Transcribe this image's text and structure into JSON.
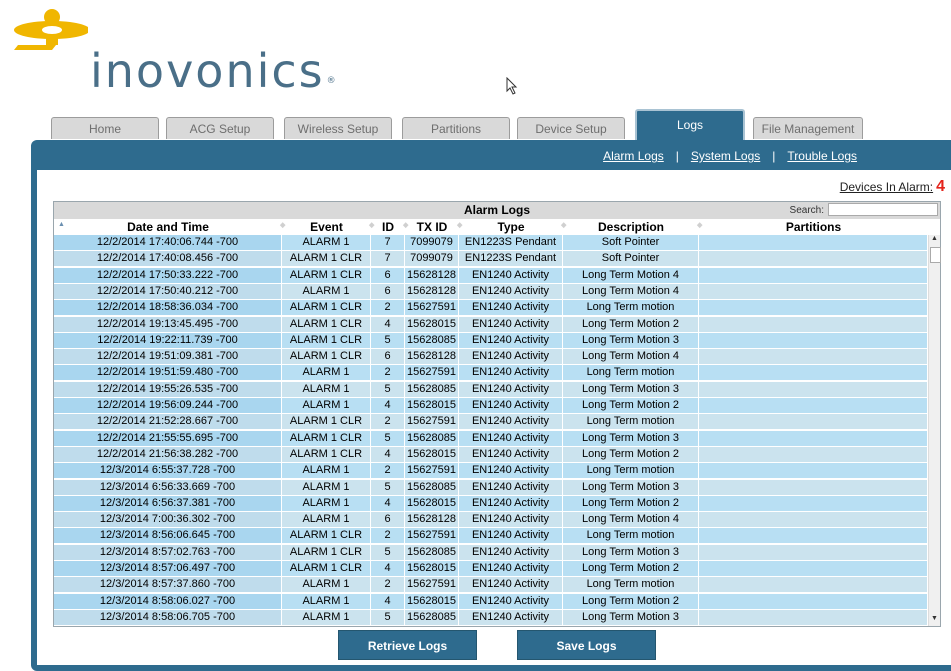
{
  "brand": {
    "name": "inovonics",
    "reg": "®",
    "logo_color": "#4a6f88",
    "accent": "#f0b600"
  },
  "tabs": [
    {
      "label": "Home",
      "active": false
    },
    {
      "label": "ACG Setup",
      "active": false
    },
    {
      "label": "Wireless Setup",
      "active": false
    },
    {
      "label": "Partitions",
      "active": false
    },
    {
      "label": "Device Setup",
      "active": false
    },
    {
      "label": "Logs",
      "active": true
    },
    {
      "label": "File Management",
      "active": false
    }
  ],
  "subnav": {
    "alarm_logs": "Alarm Logs",
    "system_logs": "System Logs",
    "trouble_logs": "Trouble Logs",
    "separator": "|"
  },
  "devices_in_alarm": {
    "label": "Devices In Alarm:",
    "count": "4"
  },
  "table": {
    "title": "Alarm Logs",
    "search_label": "Search:",
    "search_value": "",
    "columns": [
      "Date and Time",
      "Event",
      "ID",
      "TX ID",
      "Type",
      "Description",
      "Partitions"
    ],
    "rows": [
      [
        "12/2/2014 17:40:06.744 -700",
        "ALARM 1",
        "7",
        "7099079",
        "EN1223S Pendant",
        "Soft Pointer",
        ""
      ],
      [
        "12/2/2014 17:40:08.456 -700",
        "ALARM 1 CLR",
        "7",
        "7099079",
        "EN1223S Pendant",
        "Soft Pointer",
        ""
      ],
      [
        "12/2/2014 17:50:33.222 -700",
        "ALARM 1 CLR",
        "6",
        "15628128",
        "EN1240 Activity",
        "Long Term Motion 4",
        ""
      ],
      [
        "12/2/2014 17:50:40.212 -700",
        "ALARM 1",
        "6",
        "15628128",
        "EN1240 Activity",
        "Long Term Motion 4",
        ""
      ],
      [
        "12/2/2014 18:58:36.034 -700",
        "ALARM 1 CLR",
        "2",
        "15627591",
        "EN1240 Activity",
        "Long Term motion",
        ""
      ],
      [
        "12/2/2014 19:13:45.495 -700",
        "ALARM 1 CLR",
        "4",
        "15628015",
        "EN1240 Activity",
        "Long Term Motion 2",
        ""
      ],
      [
        "12/2/2014 19:22:11.739 -700",
        "ALARM 1 CLR",
        "5",
        "15628085",
        "EN1240 Activity",
        "Long Term Motion 3",
        ""
      ],
      [
        "12/2/2014 19:51:09.381 -700",
        "ALARM 1 CLR",
        "6",
        "15628128",
        "EN1240 Activity",
        "Long Term Motion 4",
        ""
      ],
      [
        "12/2/2014 19:51:59.480 -700",
        "ALARM 1",
        "2",
        "15627591",
        "EN1240 Activity",
        "Long Term motion",
        ""
      ],
      [
        "12/2/2014 19:55:26.535 -700",
        "ALARM 1",
        "5",
        "15628085",
        "EN1240 Activity",
        "Long Term Motion 3",
        ""
      ],
      [
        "12/2/2014 19:56:09.244 -700",
        "ALARM 1",
        "4",
        "15628015",
        "EN1240 Activity",
        "Long Term Motion 2",
        ""
      ],
      [
        "12/2/2014 21:52:28.667 -700",
        "ALARM 1 CLR",
        "2",
        "15627591",
        "EN1240 Activity",
        "Long Term motion",
        ""
      ],
      [
        "12/2/2014 21:55:55.695 -700",
        "ALARM 1 CLR",
        "5",
        "15628085",
        "EN1240 Activity",
        "Long Term Motion 3",
        ""
      ],
      [
        "12/2/2014 21:56:38.282 -700",
        "ALARM 1 CLR",
        "4",
        "15628015",
        "EN1240 Activity",
        "Long Term Motion 2",
        ""
      ],
      [
        "12/3/2014 6:55:37.728 -700",
        "ALARM 1",
        "2",
        "15627591",
        "EN1240 Activity",
        "Long Term motion",
        ""
      ],
      [
        "12/3/2014 6:56:33.669 -700",
        "ALARM 1",
        "5",
        "15628085",
        "EN1240 Activity",
        "Long Term Motion 3",
        ""
      ],
      [
        "12/3/2014 6:56:37.381 -700",
        "ALARM 1",
        "4",
        "15628015",
        "EN1240 Activity",
        "Long Term Motion 2",
        ""
      ],
      [
        "12/3/2014 7:00:36.302 -700",
        "ALARM 1",
        "6",
        "15628128",
        "EN1240 Activity",
        "Long Term Motion 4",
        ""
      ],
      [
        "12/3/2014 8:56:06.645 -700",
        "ALARM 1 CLR",
        "2",
        "15627591",
        "EN1240 Activity",
        "Long Term motion",
        ""
      ],
      [
        "12/3/2014 8:57:02.763 -700",
        "ALARM 1 CLR",
        "5",
        "15628085",
        "EN1240 Activity",
        "Long Term Motion 3",
        ""
      ],
      [
        "12/3/2014 8:57:06.497 -700",
        "ALARM 1 CLR",
        "4",
        "15628015",
        "EN1240 Activity",
        "Long Term Motion 2",
        ""
      ],
      [
        "12/3/2014 8:57:37.860 -700",
        "ALARM 1",
        "2",
        "15627591",
        "EN1240 Activity",
        "Long Term motion",
        ""
      ],
      [
        "12/3/2014 8:58:06.027 -700",
        "ALARM 1",
        "4",
        "15628015",
        "EN1240 Activity",
        "Long Term Motion 2",
        ""
      ],
      [
        "12/3/2014 8:58:06.705 -700",
        "ALARM 1",
        "5",
        "15628085",
        "EN1240 Activity",
        "Long Term Motion 3",
        ""
      ]
    ]
  },
  "buttons": {
    "retrieve": "Retrieve Logs",
    "save": "Save Logs"
  },
  "colors": {
    "panel": "#2e6b8e",
    "row_odd": "#b8dff3",
    "row_even": "#cbe3ee",
    "alarm_count": "#e5231b"
  }
}
